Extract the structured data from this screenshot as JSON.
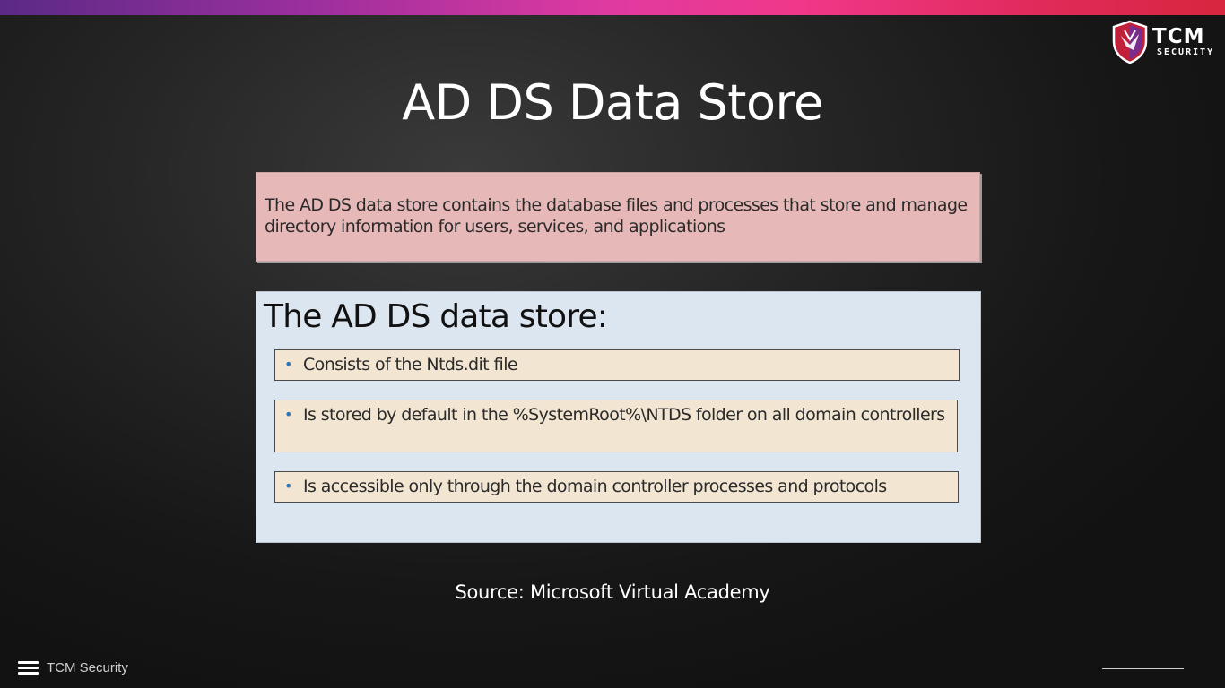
{
  "slide": {
    "title": "AD DS Data Store",
    "definition": "The AD DS data store contains the database files and processes that store and manage directory information for users, services, and applications",
    "list_heading": "The AD DS data store:",
    "bullets": [
      "Consists of the Ntds.dit file",
      "Is stored by default in the %SystemRoot%\\NTDS folder on all domain controllers",
      "Is accessible only through the domain controller processes and protocols"
    ],
    "source": "Source: Microsoft Virtual Academy"
  },
  "logo": {
    "main": "TCM",
    "sub": "SECURITY"
  },
  "footer": {
    "brand": "TCM Security",
    "menu_icon": "hamburger-menu-icon"
  },
  "colors": {
    "accent_gradient_start": "#5b2a86",
    "accent_gradient_mid": "#f0388a",
    "accent_gradient_end": "#d8263e",
    "definition_box": "#e6b8b7",
    "list_box": "#dce6f1",
    "bullet_box": "#f2e6d2",
    "bullet_dot": "#2e75b6"
  }
}
